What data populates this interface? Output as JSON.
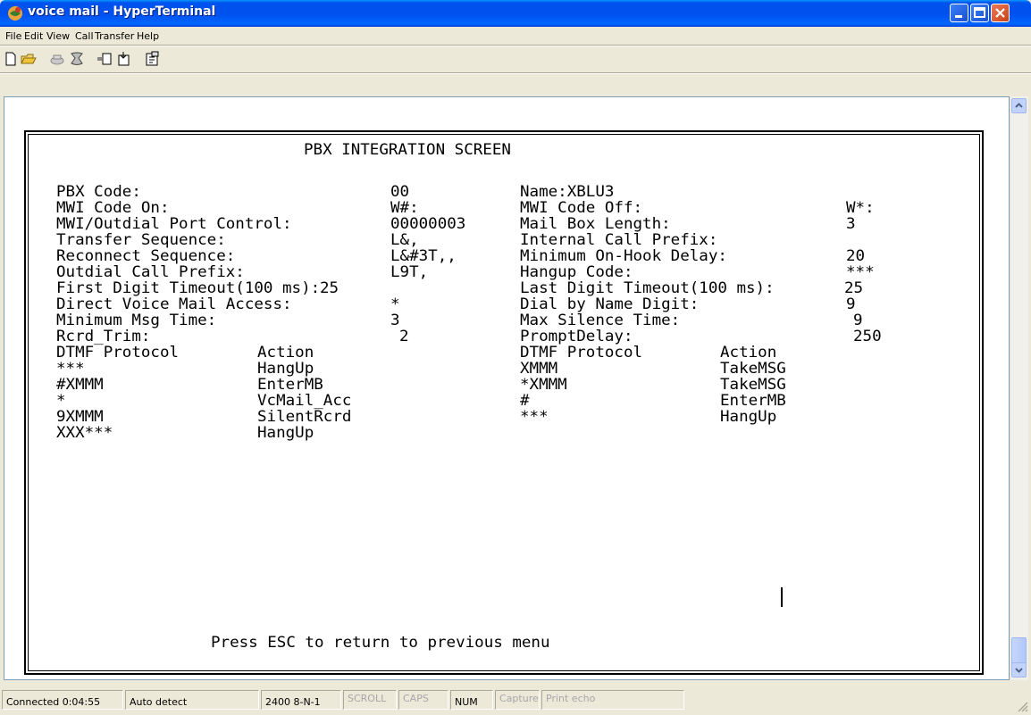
{
  "window": {
    "title": "voice mail - HyperTerminal"
  },
  "menu": [
    "File",
    "Edit",
    "View",
    "Call",
    "Transfer",
    "Help"
  ],
  "toolbar_icons": [
    "new-icon",
    "open-icon",
    "disconnect-icon",
    "dial-icon",
    "send-icon",
    "receive-icon",
    "properties-icon"
  ],
  "terminal": {
    "heading": "PBX INTEGRATION SCREEN",
    "left_rows": [
      {
        "label": "PBX Code:",
        "value": "00"
      },
      {
        "label": "MWI Code On:",
        "value": "W#:"
      },
      {
        "label": "MWI/Outdial Port Control:",
        "value": "00000003"
      },
      {
        "label": "Transfer Sequence:",
        "value": "L&,"
      },
      {
        "label": "Reconnect Sequence:",
        "value": "L&#3T,,"
      },
      {
        "label": "Outdial Call Prefix:",
        "value": "L9T,"
      },
      {
        "label": "First Digit Timeout(100 ms):",
        "value": "25"
      },
      {
        "label": "Direct Voice Mail Access:",
        "value": "*"
      },
      {
        "label": "Minimum Msg Time:",
        "value": "3"
      },
      {
        "label": "Rcrd_Trim:",
        "value": "2"
      }
    ],
    "right_rows": [
      {
        "label": "Name:XBLU3",
        "value": ""
      },
      {
        "label": "MWI Code Off:",
        "value": "W*:"
      },
      {
        "label": "Mail Box Length:",
        "value": "3"
      },
      {
        "label": "Internal Call Prefix:",
        "value": ""
      },
      {
        "label": "Minimum On-Hook Delay:",
        "value": "20"
      },
      {
        "label": "Hangup Code:",
        "value": "***"
      },
      {
        "label": "Last Digit Timeout(100 ms):",
        "value": "25"
      },
      {
        "label": "Dial by Name Digit:",
        "value": "9"
      },
      {
        "label": "Max Silence Time:",
        "value": "9"
      },
      {
        "label": "PromptDelay:",
        "value": "250"
      }
    ],
    "dtmf_left": {
      "header_protocol": "DTMF Protocol",
      "header_action": "Action",
      "rows": [
        {
          "protocol": "***",
          "action": "HangUp"
        },
        {
          "protocol": "#XMMM",
          "action": "EnterMB"
        },
        {
          "protocol": "*",
          "action": "VcMail_Acc"
        },
        {
          "protocol": "9XMMM",
          "action": "SilentRcrd"
        },
        {
          "protocol": "XXX***",
          "action": "HangUp"
        }
      ]
    },
    "dtmf_right": {
      "header_protocol": "DTMF Protocol",
      "header_action": "Action",
      "rows": [
        {
          "protocol": "XMMM",
          "action": "TakeMSG"
        },
        {
          "protocol": "*XMMM",
          "action": "TakeMSG"
        },
        {
          "protocol": "#",
          "action": "EnterMB"
        },
        {
          "protocol": "***",
          "action": "HangUp"
        }
      ]
    },
    "footer": "Press ESC to return to previous menu"
  },
  "status": {
    "connected": "Connected 0:04:55",
    "detect": "Auto detect",
    "settings": "2400 8-N-1",
    "scroll": "SCROLL",
    "caps": "CAPS",
    "num": "NUM",
    "capture": "Capture",
    "print_echo": "Print echo"
  }
}
